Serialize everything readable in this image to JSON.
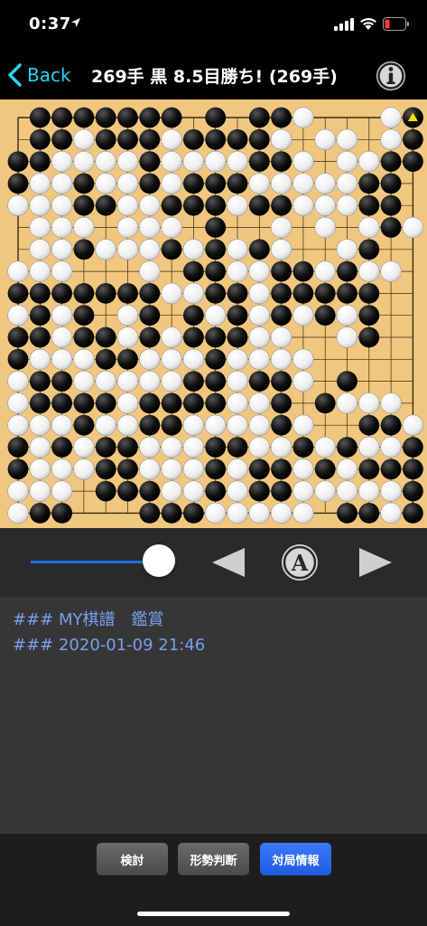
{
  "status_bar": {
    "time": "0:37",
    "location_icon": "location-arrow-icon",
    "signal_icon": "cellular-signal-icon",
    "wifi_icon": "wifi-icon",
    "battery_icon": "battery-low-icon",
    "battery_color": "#ff3b30"
  },
  "nav": {
    "back_label": "Back",
    "title": "269手 黒 8.5目勝ち! (269手)",
    "info_icon": "info-icon",
    "accent_color": "#2ad2f5"
  },
  "board": {
    "size": 19,
    "last_move_marker": "triangle",
    "rows": [
      "_BBBBBBB_B_BBW___WM",
      "_BBWBBBWBBBBW_WW_WB",
      "BBWWWWBWWWWBBW_WWBB",
      "BWWBWWBWBBBWWWWWBB_",
      "WWWBBWWBBBWBBWWWBB_",
      "_WWW_WWW_B__W_W_WBW",
      "_WWBWWWBWBWBW__WB__",
      "WWW___W_BBWWBBWBWW_",
      "BBBBBBBWWBBWBBBBB__",
      "WBWB_WB_BWBWBWBWB__",
      "BBWBBWBWBBBWW__WB__",
      "BWWWBBWWWBWWWW_____",
      "WBBWWWWWBBWBBW_B___",
      "WBBBBWBBBBWWB_BWWW_",
      "WWWBWWBBWWWWBW__BBW",
      "BWBWBBWWWBBWWBWBWWB",
      "BWWWBBWWWBWBBWBWBBB",
      "WWW_BBBWWBWBBWWWWWB",
      "WBB___BBBWWWWW_BBWB"
    ],
    "star_points": [
      [
        3,
        3
      ],
      [
        3,
        9
      ],
      [
        3,
        15
      ],
      [
        9,
        3
      ],
      [
        9,
        9
      ],
      [
        9,
        15
      ],
      [
        15,
        3
      ],
      [
        15,
        9
      ],
      [
        15,
        15
      ]
    ],
    "wood_color": "#f1c77f"
  },
  "controls": {
    "slider_value": 1.0,
    "prev_icon": "triangle-left-icon",
    "auto_icon": "circled-a-icon",
    "next_icon": "triangle-right-icon",
    "slider_color": "#1a6fe8"
  },
  "comments": [
    "### MY棋譜　鑑賞",
    "### 2020-01-09 21:46"
  ],
  "toolbar": {
    "examine_label": "検討",
    "judge_label": "形勢判断",
    "info_label": "対局情報"
  }
}
